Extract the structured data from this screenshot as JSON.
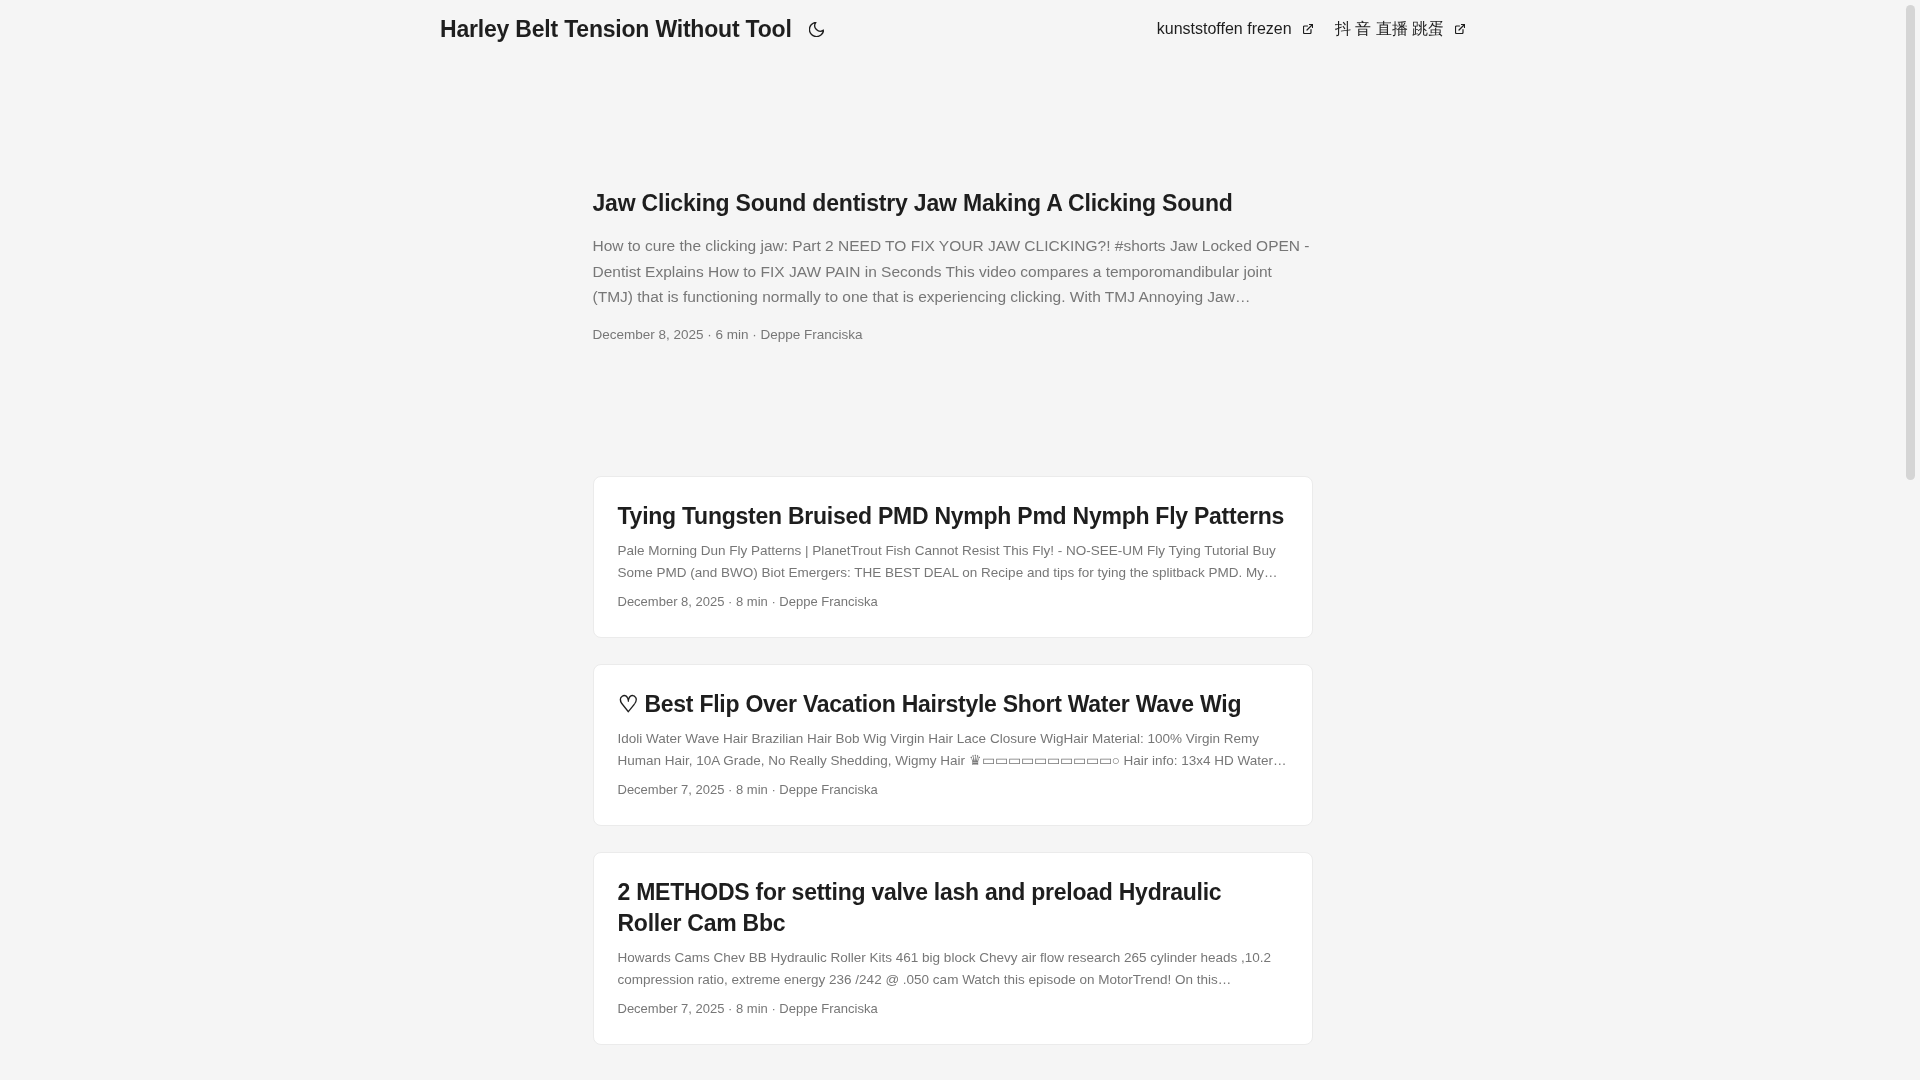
{
  "header": {
    "title": "Harley Belt Tension Without Tool",
    "links": [
      {
        "label": "kunststoffen frezen"
      },
      {
        "label": "抖 音 直播 跳蛋"
      }
    ]
  },
  "featured": {
    "title": "Jaw Clicking Sound dentistry Jaw Making A Clicking Sound",
    "summary": "How to cure the clicking jaw: Part 2 NEED TO FIX YOUR JAW CLICKING?! #shorts Jaw Locked OPEN - Dentist Explains How to FIX JAW PAIN in Seconds This video compares a temporomandibular joint (TMJ) that is functioning normally to one that is experiencing clicking. With TMJ Annoying Jaw…",
    "meta": "December 8, 2025 · 6 min · Deppe Franciska"
  },
  "posts": [
    {
      "title": "Tying Tungsten Bruised PMD Nymph Pmd Nymph Fly Patterns",
      "summary": "Pale Morning Dun Fly Patterns | PlanetTrout Fish Cannot Resist This Fly! - NO-SEE-UM Fly Tying Tutorial Buy Some PMD (and BWO) Biot Emergers: THE BEST DEAL on Recipe and tips for tying the splitback PMD. My…",
      "meta": "December 8, 2025 · 8 min · Deppe Franciska"
    },
    {
      "title": "♡ Best Flip Over Vacation Hairstyle Short Water Wave Wig",
      "summary": "Idoli Water Wave Hair Brazilian Hair Bob Wig Virgin Hair Lace Closure WigHair Material: 100% Virgin Remy Human Hair, 10A Grade, No Really Shedding, Wigmy Hair ♛▭▭▭▭▭▭▭▭▭▭○ Hair info: 13x4 HD Water…",
      "meta": "December 7, 2025 · 8 min · Deppe Franciska"
    },
    {
      "title": "2 METHODS for setting valve lash and preload Hydraulic Roller Cam Bbc",
      "summary": "Howards Cams Chev BB Hydraulic Roller Kits 461 big block Chevy air flow research 265 cylinder heads ,10.2 compression ratio, extreme energy 236 /242 @ .050 cam Watch this episode on MotorTrend! On this…",
      "meta": "December 7, 2025 · 8 min · Deppe Franciska"
    }
  ]
}
